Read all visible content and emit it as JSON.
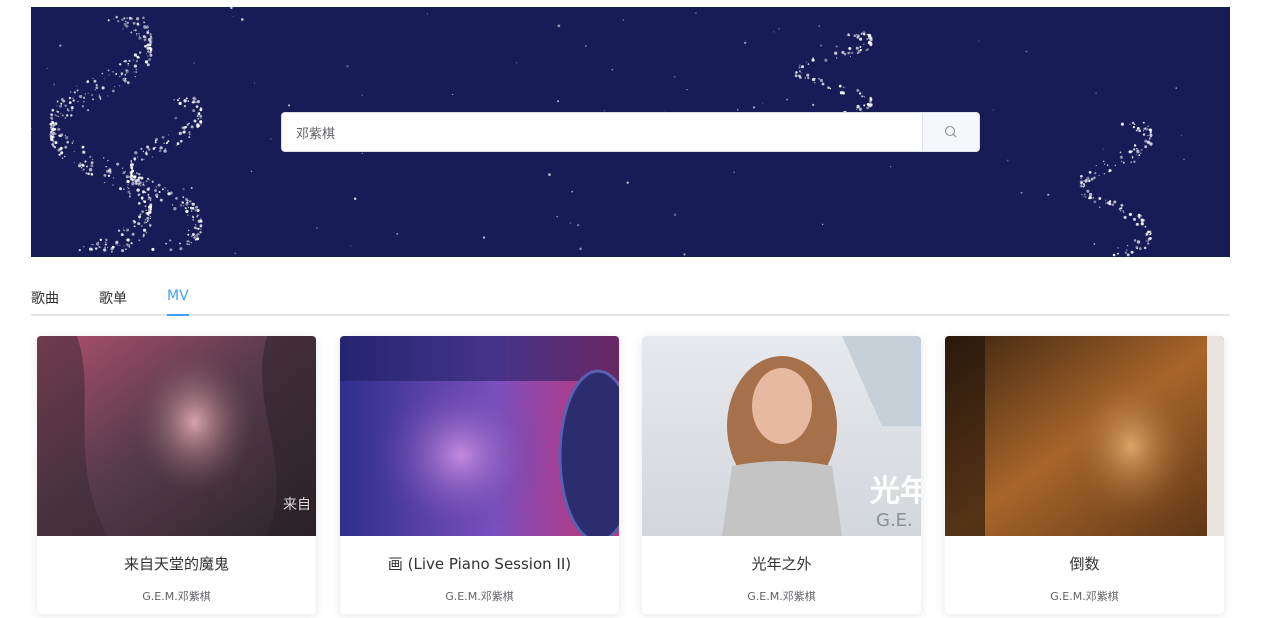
{
  "search": {
    "value": "邓紫棋"
  },
  "tabs": [
    {
      "label": "歌曲"
    },
    {
      "label": "歌单"
    },
    {
      "label": "MV"
    }
  ],
  "active_tab": "MV",
  "mvs": [
    {
      "title": "来自天堂的魔鬼",
      "artist": "G.E.M.邓紫棋",
      "thumb_text": "来自"
    },
    {
      "title": "画 (Live Piano Session II)",
      "artist": "G.E.M.邓紫棋",
      "thumb_text": ""
    },
    {
      "title": "光年之外",
      "artist": "G.E.M.邓紫棋",
      "thumb_text": "光年",
      "thumb_subtext": "G.E."
    },
    {
      "title": "倒数",
      "artist": "G.E.M.邓紫棋",
      "thumb_text": ""
    }
  ],
  "colors": {
    "banner": "#171c56",
    "accent": "#409eff"
  }
}
